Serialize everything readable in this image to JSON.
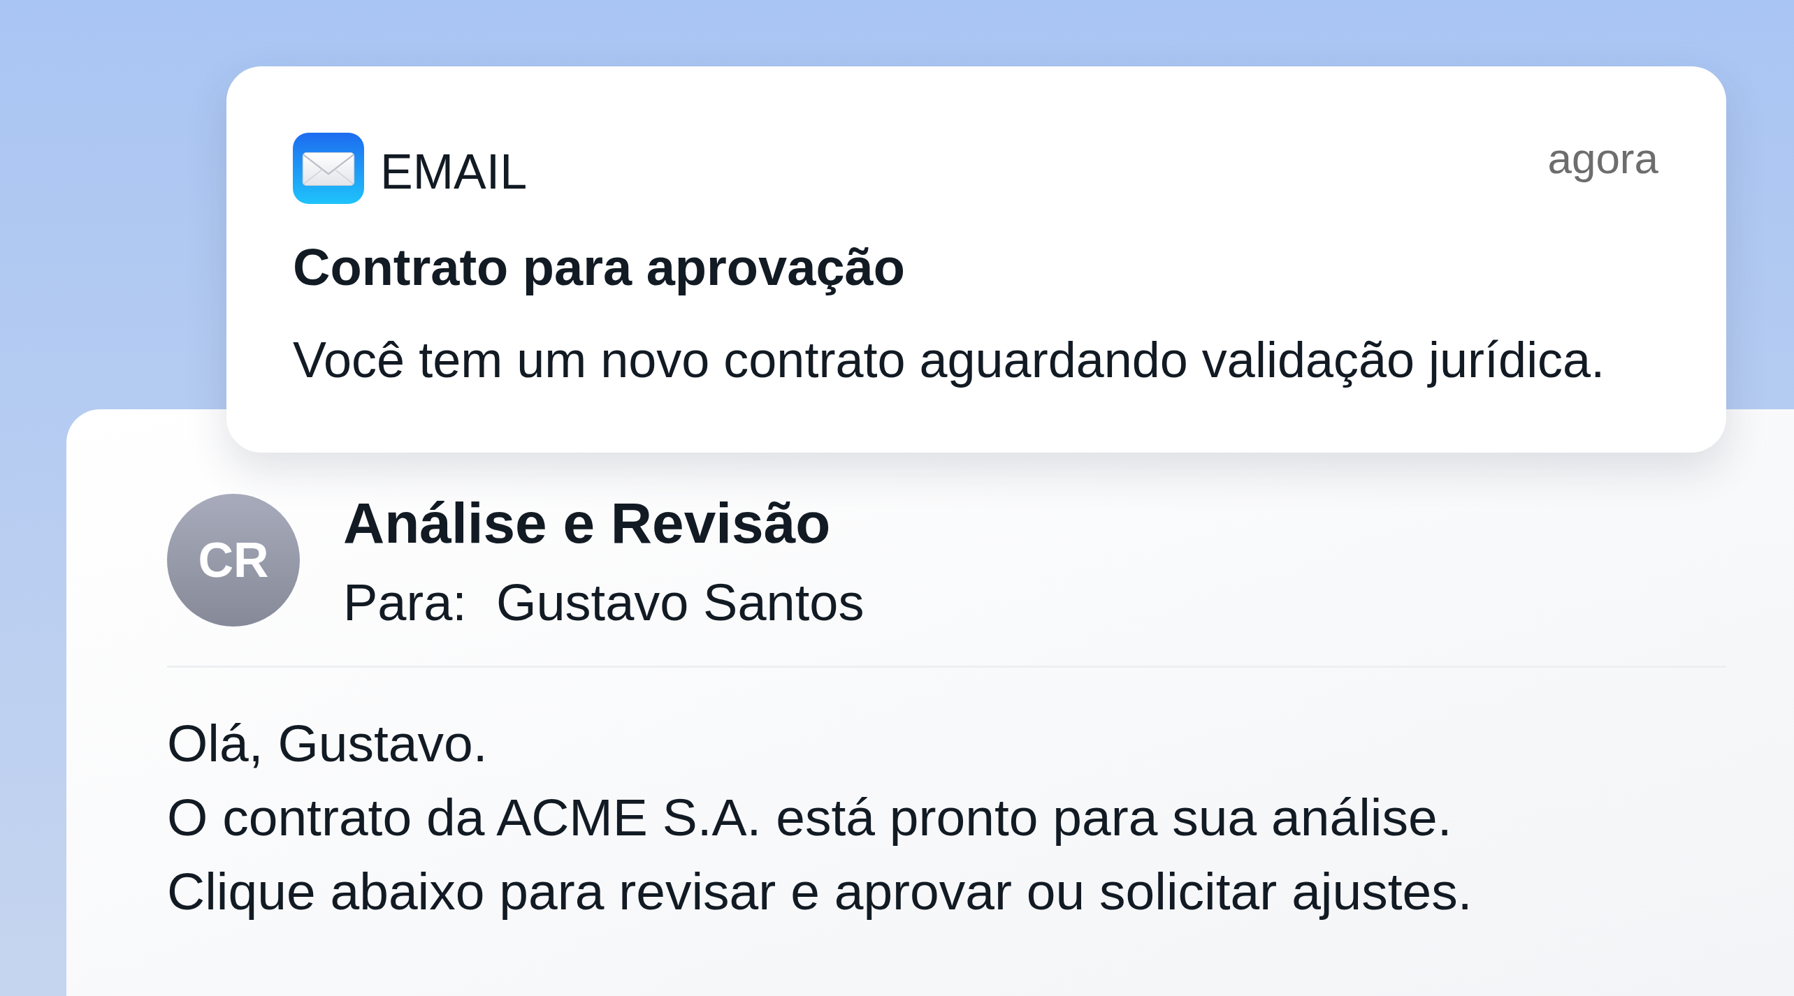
{
  "notification": {
    "app_name": "EMAIL",
    "time": "agora",
    "title": "Contrato para aprovação",
    "message": "Você tem um novo contrato aguardando validação jurídica."
  },
  "email": {
    "sender_initials": "CR",
    "subject": "Análise e Revisão",
    "to_label": "Para:",
    "recipient": "Gustavo Santos",
    "body": [
      "Olá, Gustavo.",
      "O contrato da ACME S.A. está pronto para sua análise.",
      "Clique abaixo para revisar e aprovar ou solicitar ajustes."
    ]
  }
}
